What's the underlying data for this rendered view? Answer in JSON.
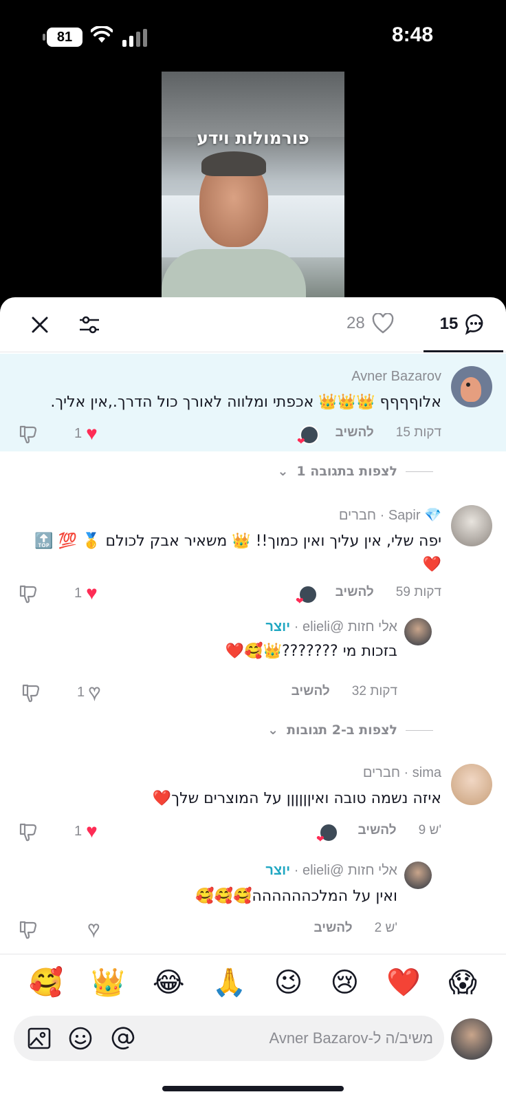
{
  "status_bar": {
    "battery": "81",
    "time": "8:48"
  },
  "video": {
    "caption": "פורמולות וידע"
  },
  "sheet": {
    "likes_count": "28",
    "comments_count": "15"
  },
  "comments": [
    {
      "name": "Avner Bazarov",
      "tag": "",
      "text": "אלוףףףף 👑👑👑 אכפתי ומלווה לאורך כול הדרך.,אין אליך.",
      "time": "15 דקות",
      "reply": "להשיב",
      "likes": "1",
      "liked": true,
      "creator_liked": true
    },
    {
      "name": "Sapir",
      "badge": "💎",
      "tag": "חברים",
      "text": "יפה שלי, אין עליך ואין כמוך!! 👑 משאיר אבק לכולם 🥇 💯 🔝 ❤️",
      "time": "59 דקות",
      "reply": "להשיב",
      "likes": "1",
      "liked": true,
      "creator_liked": true
    },
    {
      "name": "אלי חזות @elieli",
      "tag": "יוצר",
      "text": "בזכות מי ???????👑🥰❤️",
      "time": "32 דקות",
      "reply": "להשיב",
      "likes": "1",
      "liked": false
    },
    {
      "name": "sima",
      "tag": "חברים",
      "text": "איזה נשמה טובה ואיןןןןןן על המוצרים שלך❤️",
      "time": "9 ש'",
      "reply": "להשיב",
      "likes": "1",
      "liked": true,
      "creator_liked": true
    },
    {
      "name": "אלי חזות @elieli",
      "tag": "יוצר",
      "text": "ואין על המלכהההההה🥰🥰🥰",
      "time": "2 ש'",
      "reply": "להשיב",
      "likes": "",
      "liked": false
    }
  ],
  "view_replies": [
    {
      "label": "לצפות בתגובה 1"
    },
    {
      "label": "לצפות ב-2 תגובות"
    }
  ],
  "emoji_bar": [
    "🥰",
    "👑",
    "😂",
    "🙏",
    "😉",
    "😢",
    "❤️",
    "😱"
  ],
  "input": {
    "placeholder": "משיב/ה ל-Avner Bazarov"
  },
  "colors": {
    "accent": "#fe2c55",
    "creator": "#20a7c2",
    "highlight_bg": "#e9f7fb",
    "muted": "#8a8b91"
  },
  "icons": [
    "close-icon",
    "filter-icon",
    "heart-icon",
    "comment-icon",
    "dislike-icon",
    "image-icon",
    "emoji-icon",
    "at-icon"
  ]
}
